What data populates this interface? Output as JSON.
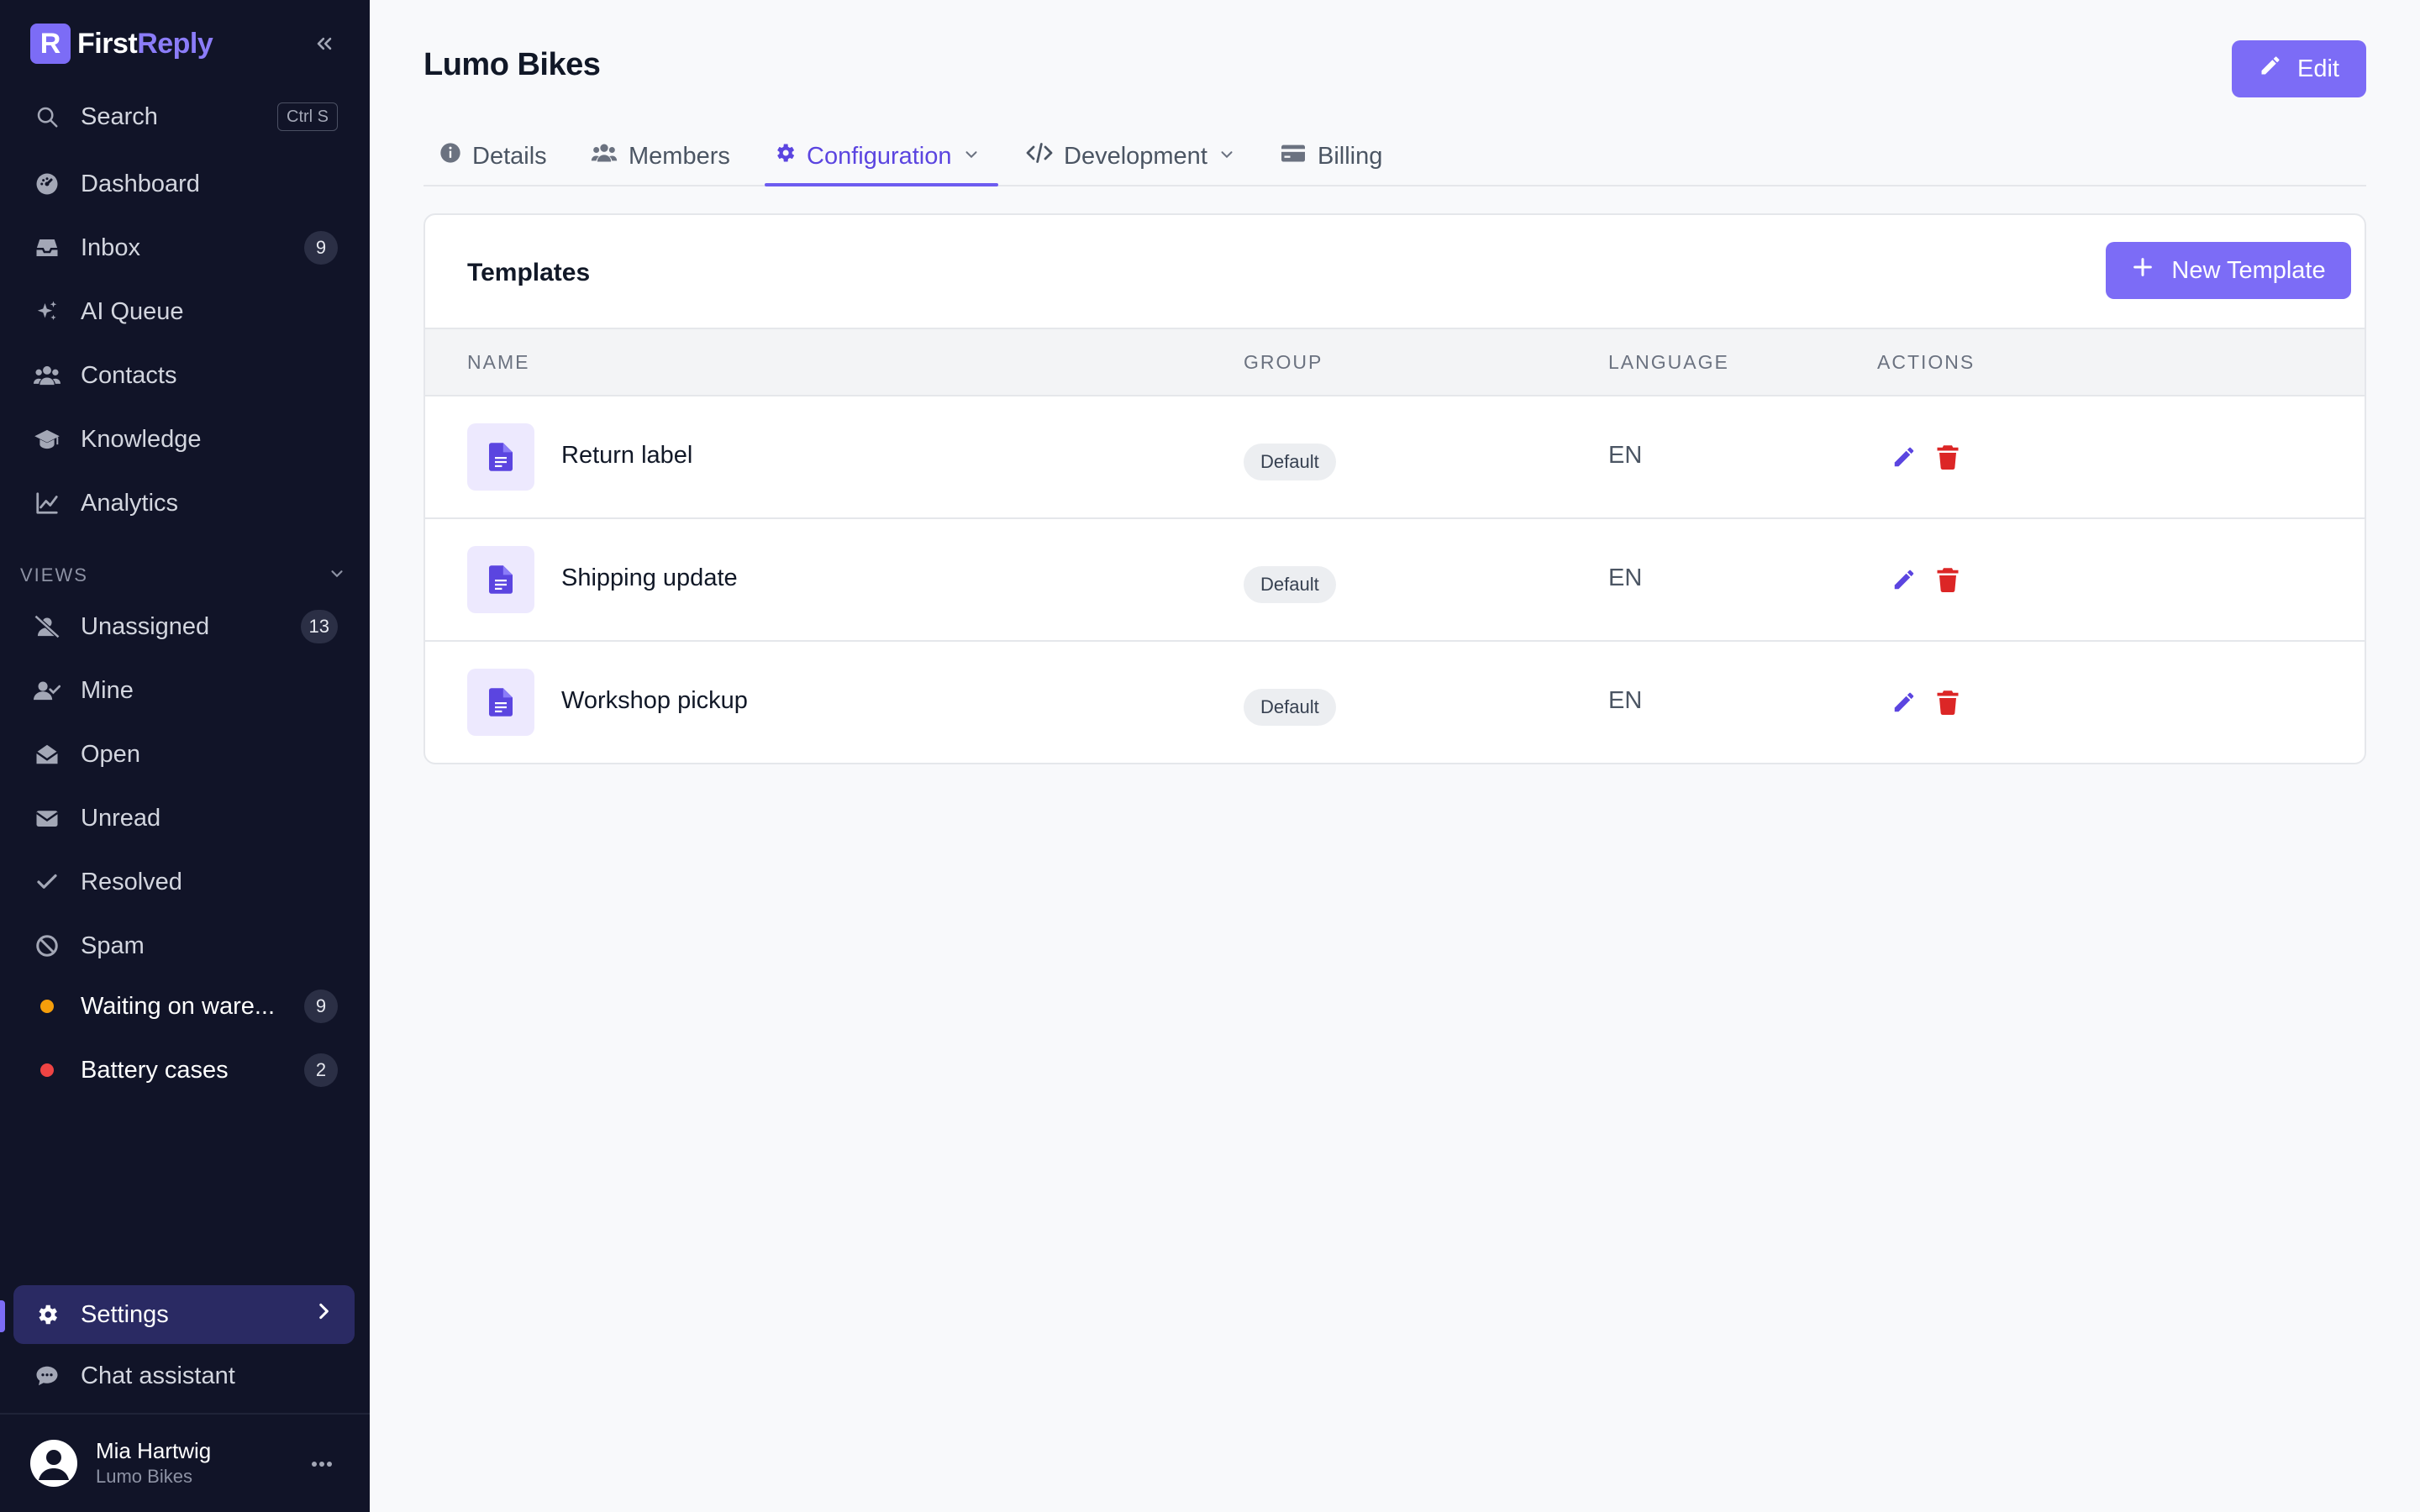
{
  "brand": {
    "name_first": "First",
    "name_second": "Reply",
    "logo_letter": "R"
  },
  "sidebar": {
    "search": {
      "label": "Search",
      "shortcut": "Ctrl S"
    },
    "items": [
      {
        "label": "Dashboard",
        "icon": "dashboard-icon"
      },
      {
        "label": "Inbox",
        "icon": "inbox-icon",
        "count": "9"
      },
      {
        "label": "AI Queue",
        "icon": "sparkles-icon"
      },
      {
        "label": "Contacts",
        "icon": "users-icon"
      },
      {
        "label": "Knowledge",
        "icon": "graduation-cap-icon"
      },
      {
        "label": "Analytics",
        "icon": "chart-line-icon"
      }
    ],
    "views_label": "VIEWS",
    "views": [
      {
        "label": "Unassigned",
        "icon": "user-slash-icon",
        "count": "13"
      },
      {
        "label": "Mine",
        "icon": "user-check-icon"
      },
      {
        "label": "Open",
        "icon": "envelope-open-icon"
      },
      {
        "label": "Unread",
        "icon": "envelope-icon"
      },
      {
        "label": "Resolved",
        "icon": "check-icon"
      },
      {
        "label": "Spam",
        "icon": "ban-icon"
      },
      {
        "label": "Waiting on ware...",
        "dot_color": "#f59e0b",
        "count": "9"
      },
      {
        "label": "Battery cases",
        "dot_color": "#ef4444",
        "count": "2"
      }
    ],
    "settings_label": "Settings",
    "chat_label": "Chat assistant",
    "user": {
      "name": "Mia Hartwig",
      "org": "Lumo Bikes"
    }
  },
  "page": {
    "title": "Lumo Bikes",
    "edit_label": "Edit"
  },
  "tabs": [
    {
      "label": "Details"
    },
    {
      "label": "Members"
    },
    {
      "label": "Configuration",
      "active": true
    },
    {
      "label": "Development"
    },
    {
      "label": "Billing"
    }
  ],
  "templates": {
    "title": "Templates",
    "new_label": "New Template",
    "columns": [
      "NAME",
      "GROUP",
      "LANGUAGE",
      "ACTIONS"
    ],
    "rows": [
      {
        "name": "Return label",
        "group": "Default",
        "language": "EN"
      },
      {
        "name": "Shipping update",
        "group": "Default",
        "language": "EN"
      },
      {
        "name": "Workshop pickup",
        "group": "Default",
        "language": "EN"
      }
    ]
  },
  "colors": {
    "accent": "#7c6cf6",
    "sidebar_bg": "#111428",
    "danger": "#dc2626"
  }
}
